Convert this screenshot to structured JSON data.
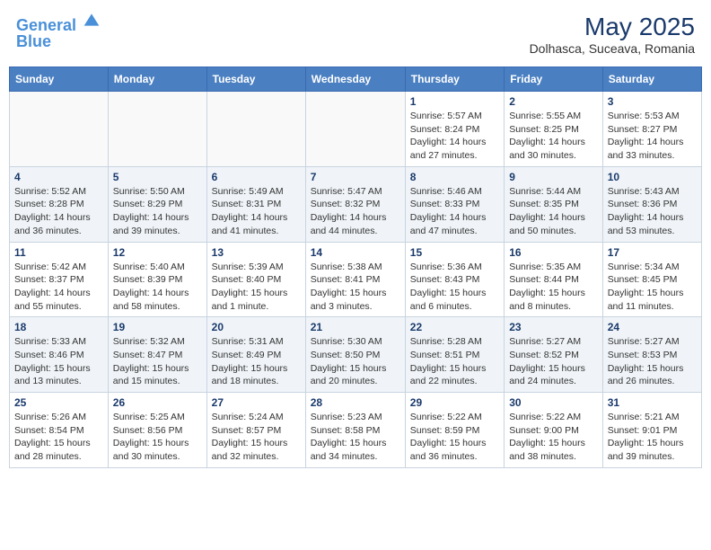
{
  "header": {
    "logo_line1": "General",
    "logo_line2": "Blue",
    "month_year": "May 2025",
    "location": "Dolhasca, Suceava, Romania"
  },
  "days_of_week": [
    "Sunday",
    "Monday",
    "Tuesday",
    "Wednesday",
    "Thursday",
    "Friday",
    "Saturday"
  ],
  "weeks": [
    [
      {
        "day": "",
        "info": ""
      },
      {
        "day": "",
        "info": ""
      },
      {
        "day": "",
        "info": ""
      },
      {
        "day": "",
        "info": ""
      },
      {
        "day": "1",
        "info": "Sunrise: 5:57 AM\nSunset: 8:24 PM\nDaylight: 14 hours and 27 minutes."
      },
      {
        "day": "2",
        "info": "Sunrise: 5:55 AM\nSunset: 8:25 PM\nDaylight: 14 hours and 30 minutes."
      },
      {
        "day": "3",
        "info": "Sunrise: 5:53 AM\nSunset: 8:27 PM\nDaylight: 14 hours and 33 minutes."
      }
    ],
    [
      {
        "day": "4",
        "info": "Sunrise: 5:52 AM\nSunset: 8:28 PM\nDaylight: 14 hours and 36 minutes."
      },
      {
        "day": "5",
        "info": "Sunrise: 5:50 AM\nSunset: 8:29 PM\nDaylight: 14 hours and 39 minutes."
      },
      {
        "day": "6",
        "info": "Sunrise: 5:49 AM\nSunset: 8:31 PM\nDaylight: 14 hours and 41 minutes."
      },
      {
        "day": "7",
        "info": "Sunrise: 5:47 AM\nSunset: 8:32 PM\nDaylight: 14 hours and 44 minutes."
      },
      {
        "day": "8",
        "info": "Sunrise: 5:46 AM\nSunset: 8:33 PM\nDaylight: 14 hours and 47 minutes."
      },
      {
        "day": "9",
        "info": "Sunrise: 5:44 AM\nSunset: 8:35 PM\nDaylight: 14 hours and 50 minutes."
      },
      {
        "day": "10",
        "info": "Sunrise: 5:43 AM\nSunset: 8:36 PM\nDaylight: 14 hours and 53 minutes."
      }
    ],
    [
      {
        "day": "11",
        "info": "Sunrise: 5:42 AM\nSunset: 8:37 PM\nDaylight: 14 hours and 55 minutes."
      },
      {
        "day": "12",
        "info": "Sunrise: 5:40 AM\nSunset: 8:39 PM\nDaylight: 14 hours and 58 minutes."
      },
      {
        "day": "13",
        "info": "Sunrise: 5:39 AM\nSunset: 8:40 PM\nDaylight: 15 hours and 1 minute."
      },
      {
        "day": "14",
        "info": "Sunrise: 5:38 AM\nSunset: 8:41 PM\nDaylight: 15 hours and 3 minutes."
      },
      {
        "day": "15",
        "info": "Sunrise: 5:36 AM\nSunset: 8:43 PM\nDaylight: 15 hours and 6 minutes."
      },
      {
        "day": "16",
        "info": "Sunrise: 5:35 AM\nSunset: 8:44 PM\nDaylight: 15 hours and 8 minutes."
      },
      {
        "day": "17",
        "info": "Sunrise: 5:34 AM\nSunset: 8:45 PM\nDaylight: 15 hours and 11 minutes."
      }
    ],
    [
      {
        "day": "18",
        "info": "Sunrise: 5:33 AM\nSunset: 8:46 PM\nDaylight: 15 hours and 13 minutes."
      },
      {
        "day": "19",
        "info": "Sunrise: 5:32 AM\nSunset: 8:47 PM\nDaylight: 15 hours and 15 minutes."
      },
      {
        "day": "20",
        "info": "Sunrise: 5:31 AM\nSunset: 8:49 PM\nDaylight: 15 hours and 18 minutes."
      },
      {
        "day": "21",
        "info": "Sunrise: 5:30 AM\nSunset: 8:50 PM\nDaylight: 15 hours and 20 minutes."
      },
      {
        "day": "22",
        "info": "Sunrise: 5:28 AM\nSunset: 8:51 PM\nDaylight: 15 hours and 22 minutes."
      },
      {
        "day": "23",
        "info": "Sunrise: 5:27 AM\nSunset: 8:52 PM\nDaylight: 15 hours and 24 minutes."
      },
      {
        "day": "24",
        "info": "Sunrise: 5:27 AM\nSunset: 8:53 PM\nDaylight: 15 hours and 26 minutes."
      }
    ],
    [
      {
        "day": "25",
        "info": "Sunrise: 5:26 AM\nSunset: 8:54 PM\nDaylight: 15 hours and 28 minutes."
      },
      {
        "day": "26",
        "info": "Sunrise: 5:25 AM\nSunset: 8:56 PM\nDaylight: 15 hours and 30 minutes."
      },
      {
        "day": "27",
        "info": "Sunrise: 5:24 AM\nSunset: 8:57 PM\nDaylight: 15 hours and 32 minutes."
      },
      {
        "day": "28",
        "info": "Sunrise: 5:23 AM\nSunset: 8:58 PM\nDaylight: 15 hours and 34 minutes."
      },
      {
        "day": "29",
        "info": "Sunrise: 5:22 AM\nSunset: 8:59 PM\nDaylight: 15 hours and 36 minutes."
      },
      {
        "day": "30",
        "info": "Sunrise: 5:22 AM\nSunset: 9:00 PM\nDaylight: 15 hours and 38 minutes."
      },
      {
        "day": "31",
        "info": "Sunrise: 5:21 AM\nSunset: 9:01 PM\nDaylight: 15 hours and 39 minutes."
      }
    ]
  ]
}
